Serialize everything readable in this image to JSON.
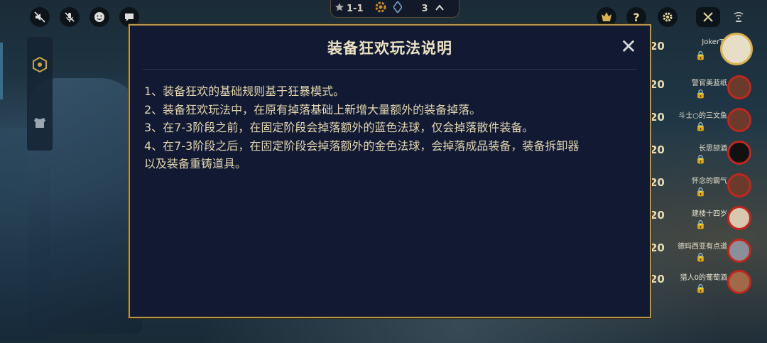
{
  "hud": {
    "stage": "1-1",
    "level": "3",
    "top_left_icons": [
      "sound-muted-icon",
      "mic-muted-icon",
      "emote-icon",
      "chat-icon"
    ],
    "top_right_icons": [
      "trophy-icon",
      "help-icon",
      "settings-icon",
      "swords-icon",
      "wifi-icon"
    ],
    "help_glyph": "?"
  },
  "dialog": {
    "title": "装备狂欢玩法说明",
    "close_glyph": "✕",
    "lines": [
      "1、装备狂欢的基础规则基于狂暴模式。",
      "2、装备狂欢玩法中，在原有掉落基础上新增大量额外的装备掉落。",
      "3、在7-3阶段之前，在固定阶段会掉落额外的蓝色法球，仅会掉落散件装备。",
      "4、在7-3阶段之后，在固定阶段会掉落额外的金色法球，会掉落成品装备，装备拆卸器",
      "以及装备重铸道具。"
    ]
  },
  "players": [
    {
      "level": "20",
      "name": "JokerTu"
    },
    {
      "level": "20",
      "name": "警官美蓝纸"
    },
    {
      "level": "20",
      "name": "斗士○的三文鱼"
    },
    {
      "level": "20",
      "name": "长思颉酒"
    },
    {
      "level": "20",
      "name": "怀念的霸气"
    },
    {
      "level": "20",
      "name": "建楼十四岁"
    },
    {
      "level": "20",
      "name": "德玛西亚有点道"
    },
    {
      "level": "20",
      "name": "猎人0的葡萄酒"
    }
  ],
  "colors": {
    "accent": "#b8954a",
    "dialog_bg": "#111933",
    "health_ring": "#c0271f"
  }
}
